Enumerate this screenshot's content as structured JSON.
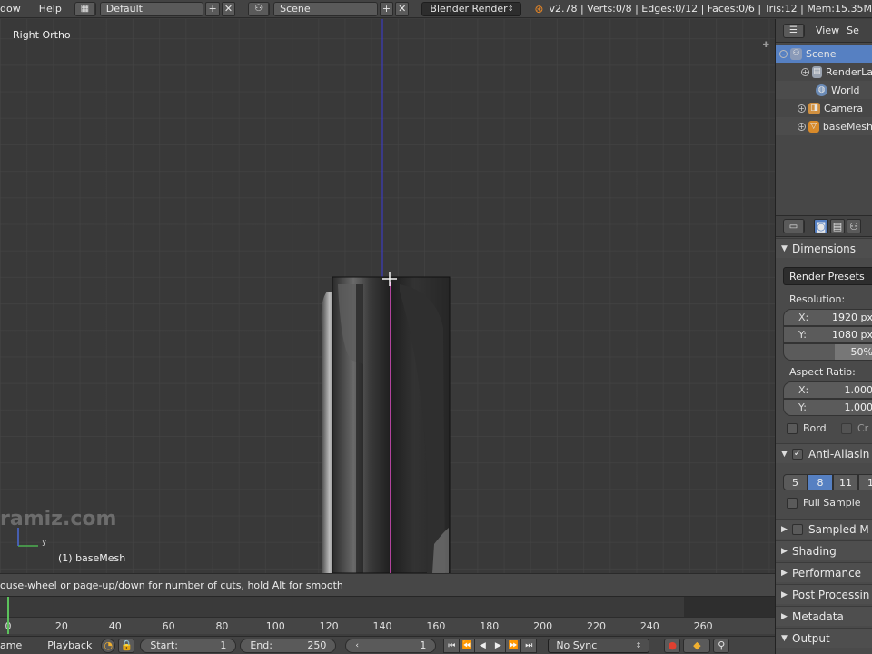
{
  "header": {
    "menus": [
      "dow",
      "Help"
    ],
    "screen_layout": "Default",
    "scene": "Scene",
    "render_engine": "Blender Render",
    "stats": "v2.78 | Verts:0/8 | Edges:0/12 | Faces:0/6 | Tris:12 | Mem:15.35M"
  },
  "viewport": {
    "view_name": "Right Ortho",
    "object_label": "(1) baseMesh",
    "watermark": "ramiz.com",
    "axis_y_label": "y"
  },
  "status": {
    "message": "ouse-wheel or page-up/down for number of cuts, hold Alt for smooth"
  },
  "timeline": {
    "ticks": [
      0,
      20,
      40,
      60,
      80,
      100,
      120,
      140,
      160,
      180,
      200,
      220,
      240,
      260
    ]
  },
  "bottom": {
    "menu_view_partial": "ame",
    "playback": "Playback",
    "start_label": "Start:",
    "start_value": "1",
    "end_label": "End:",
    "end_value": "250",
    "current_frame": "1",
    "sync": "No Sync"
  },
  "outliner": {
    "view_menu": "View",
    "search_menu_partial": "Se",
    "items": [
      {
        "label": "Scene",
        "icon": "scene-icon",
        "selected": true
      },
      {
        "label": "RenderLa",
        "icon": "render-layers-icon",
        "selected": false
      },
      {
        "label": "World",
        "icon": "world-icon",
        "selected": false
      },
      {
        "label": "Camera",
        "icon": "camera-icon",
        "selected": false
      },
      {
        "label": "baseMesh",
        "icon": "mesh-icon",
        "selected": false
      }
    ]
  },
  "properties": {
    "dimensions_title": "Dimensions",
    "render_presets": "Render Presets",
    "resolution_label": "Resolution:",
    "res_x_key": "X:",
    "res_x": "1920 px",
    "res_y_key": "Y:",
    "res_y": "1080 px",
    "res_percent": "50%",
    "aspect_label": "Aspect Ratio:",
    "aspect_x_key": "X:",
    "aspect_x": "1.000",
    "aspect_y_key": "Y:",
    "aspect_y": "1.000",
    "border": "Bord",
    "crop_partial": "Cr",
    "anti_aliasing": "Anti-Aliasin",
    "aa_samples": [
      "5",
      "8",
      "11",
      "1"
    ],
    "aa_selected": "8",
    "full_sample": "Full Sample",
    "sampled_motion": "Sampled M",
    "shading": "Shading",
    "performance": "Performance",
    "post_processing": "Post Processin",
    "metadata": "Metadata",
    "output": "Output"
  },
  "colors": {
    "selection": "#5680c2",
    "x_axis_line": "#e24fc5",
    "z_axis_line": "#3a3ad8",
    "frame_cursor": "#5cc25c",
    "blender_orange": "#f08a24"
  }
}
